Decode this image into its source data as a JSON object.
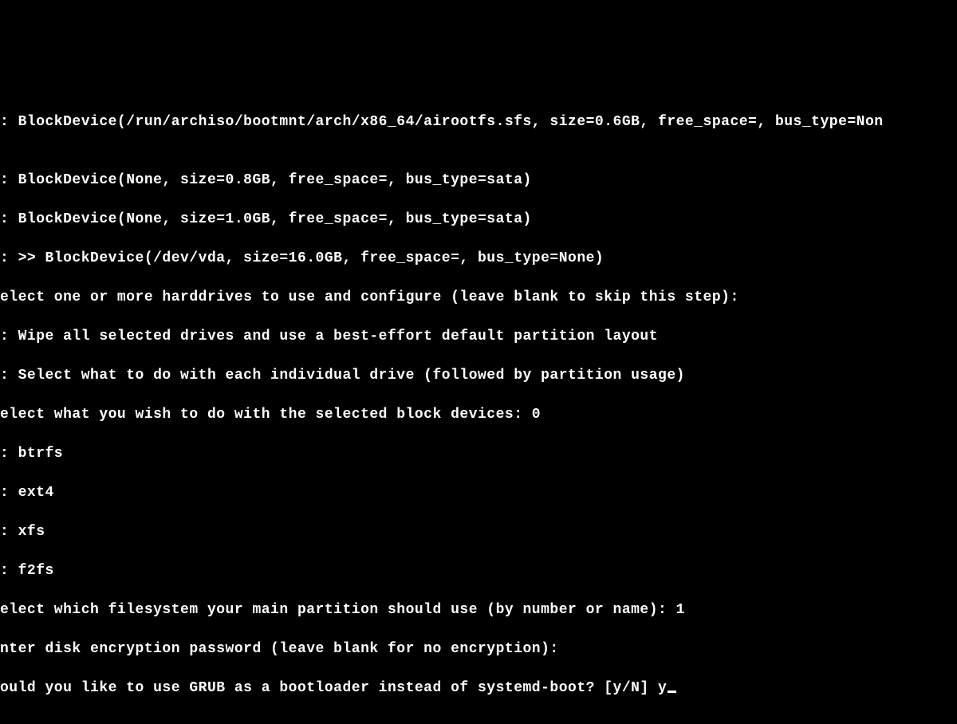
{
  "terminal": {
    "lines": [
      ": BlockDevice(/run/archiso/bootmnt/arch/x86_64/airootfs.sfs, size=0.6GB, free_space=, bus_type=Non",
      "",
      ": BlockDevice(None, size=0.8GB, free_space=, bus_type=sata)",
      ": BlockDevice(None, size=1.0GB, free_space=, bus_type=sata)",
      ": >> BlockDevice(/dev/vda, size=16.0GB, free_space=, bus_type=None)",
      "elect one or more harddrives to use and configure (leave blank to skip this step):",
      ": Wipe all selected drives and use a best-effort default partition layout",
      ": Select what to do with each individual drive (followed by partition usage)",
      "elect what you wish to do with the selected block devices: 0",
      ": btrfs",
      ": ext4",
      ": xfs",
      ": f2fs",
      "elect which filesystem your main partition should use (by number or name): 1",
      "nter disk encryption password (leave blank for no encryption):"
    ],
    "prompt_line": "ould you like to use GRUB as a bootloader instead of systemd-boot? [y/N] ",
    "user_input": "y"
  }
}
